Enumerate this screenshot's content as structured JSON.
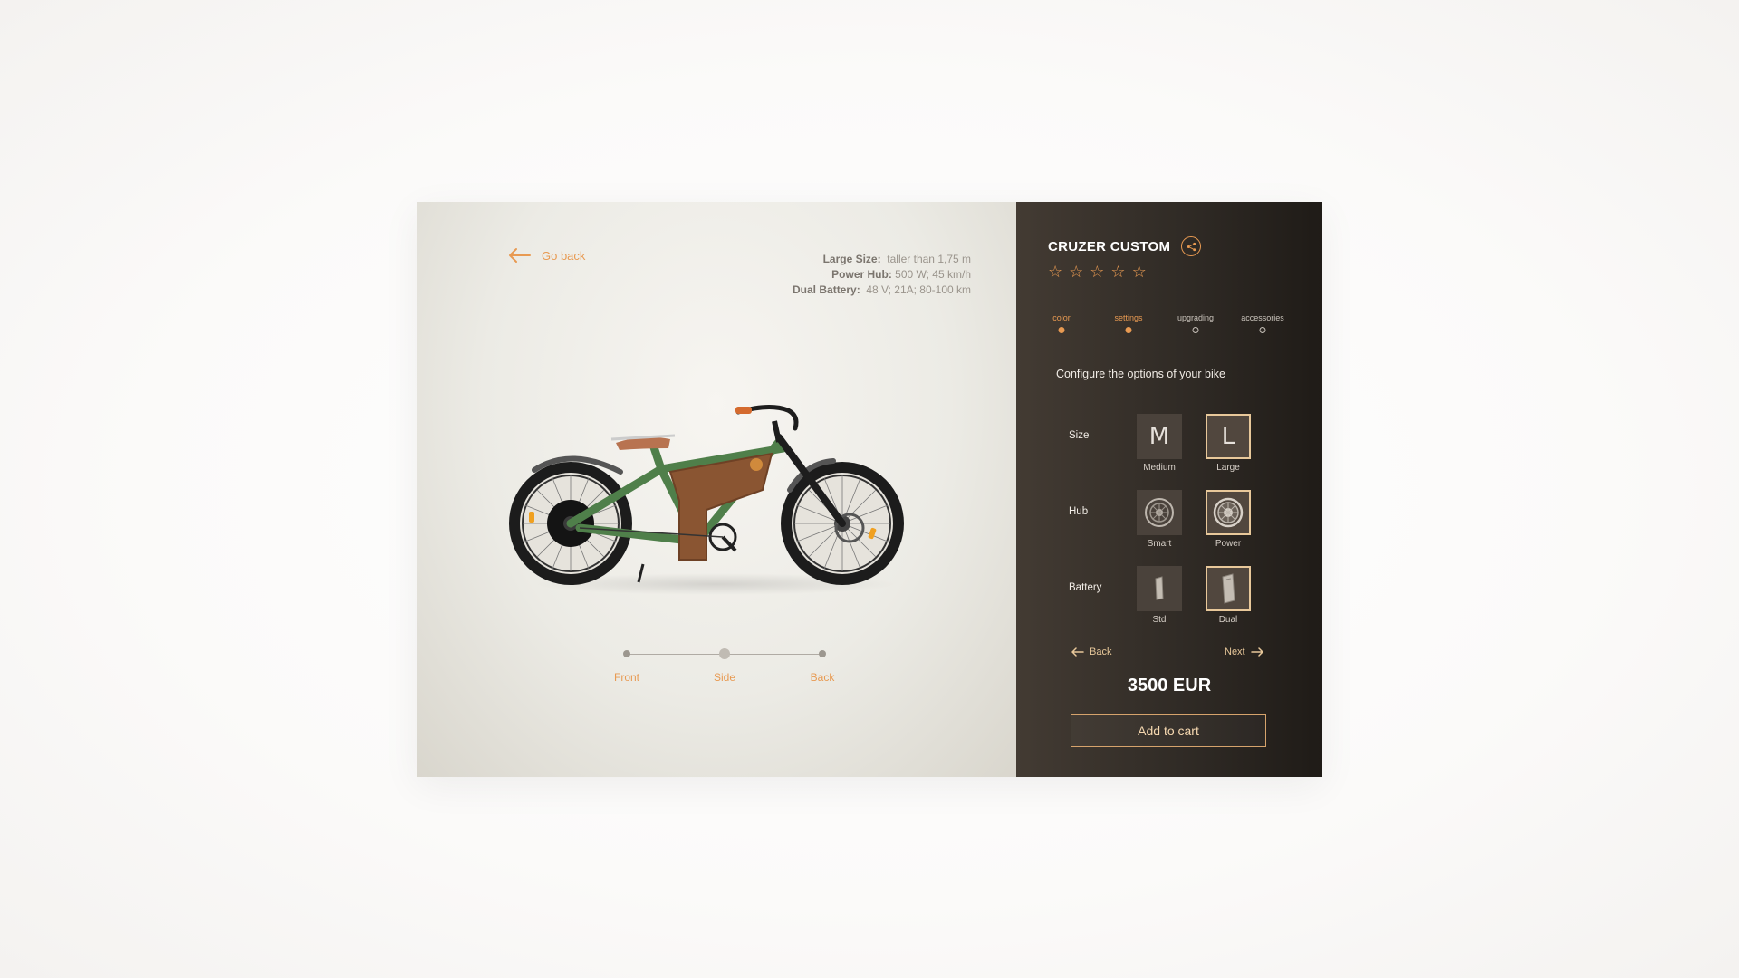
{
  "left": {
    "go_back": "Go back",
    "specs": [
      {
        "label": "Large Size:",
        "value": "taller than 1,75 m"
      },
      {
        "label": "Power Hub:",
        "value": "500 W; 45 km/h"
      },
      {
        "label": "Dual Battery:",
        "value": "48 V; 21A; 80-100 km"
      }
    ],
    "views": [
      "Front",
      "Side",
      "Back"
    ],
    "active_view": "Side"
  },
  "right": {
    "title": "CRUZER CUSTOM",
    "rating": {
      "max": 5,
      "value": 0
    },
    "steps": [
      {
        "label": "color",
        "done": true
      },
      {
        "label": "settings",
        "done": true
      },
      {
        "label": "upgrading",
        "done": false
      },
      {
        "label": "accessories",
        "done": false
      }
    ],
    "config_title": "Configure the options of your bike",
    "options": {
      "size": {
        "label": "Size",
        "items": [
          {
            "glyph": "M",
            "caption": "Medium"
          },
          {
            "glyph": "L",
            "caption": "Large"
          }
        ],
        "selected": "Large"
      },
      "hub": {
        "label": "Hub",
        "items": [
          {
            "caption": "Smart"
          },
          {
            "caption": "Power"
          }
        ],
        "selected": "Power"
      },
      "battery": {
        "label": "Battery",
        "items": [
          {
            "caption": "Std"
          },
          {
            "caption": "Dual"
          }
        ],
        "selected": "Dual"
      }
    },
    "back_label": "Back",
    "next_label": "Next",
    "price": "3500 EUR",
    "cart_label": "Add to cart"
  },
  "colors": {
    "accent": "#e89a52",
    "panel_dark": "#2e2924",
    "bike_frame": "#4f7f4a",
    "bike_tank": "#8a5532"
  }
}
